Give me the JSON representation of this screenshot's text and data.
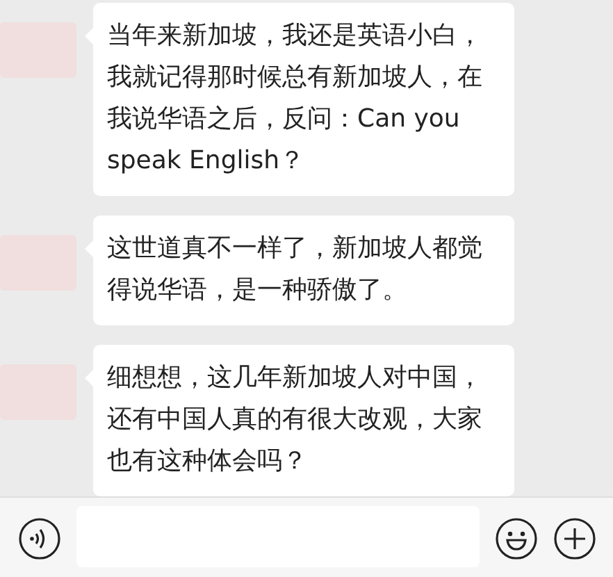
{
  "messages": [
    {
      "lines": [
        "当年来新加坡，我还是英语小白，",
        "我就记得那时候总有新加坡人，在",
        "我说华语之后，反问：Can you",
        "speak English？"
      ]
    },
    {
      "lines": [
        "这世道真不一样了，新加坡人都觉",
        "得说华语，是一种骄傲了。"
      ]
    },
    {
      "lines": [
        "细想想，这几年新加坡人对中国，",
        "还有中国人真的有很大改观，大家",
        "也有这种体会吗？"
      ]
    }
  ]
}
